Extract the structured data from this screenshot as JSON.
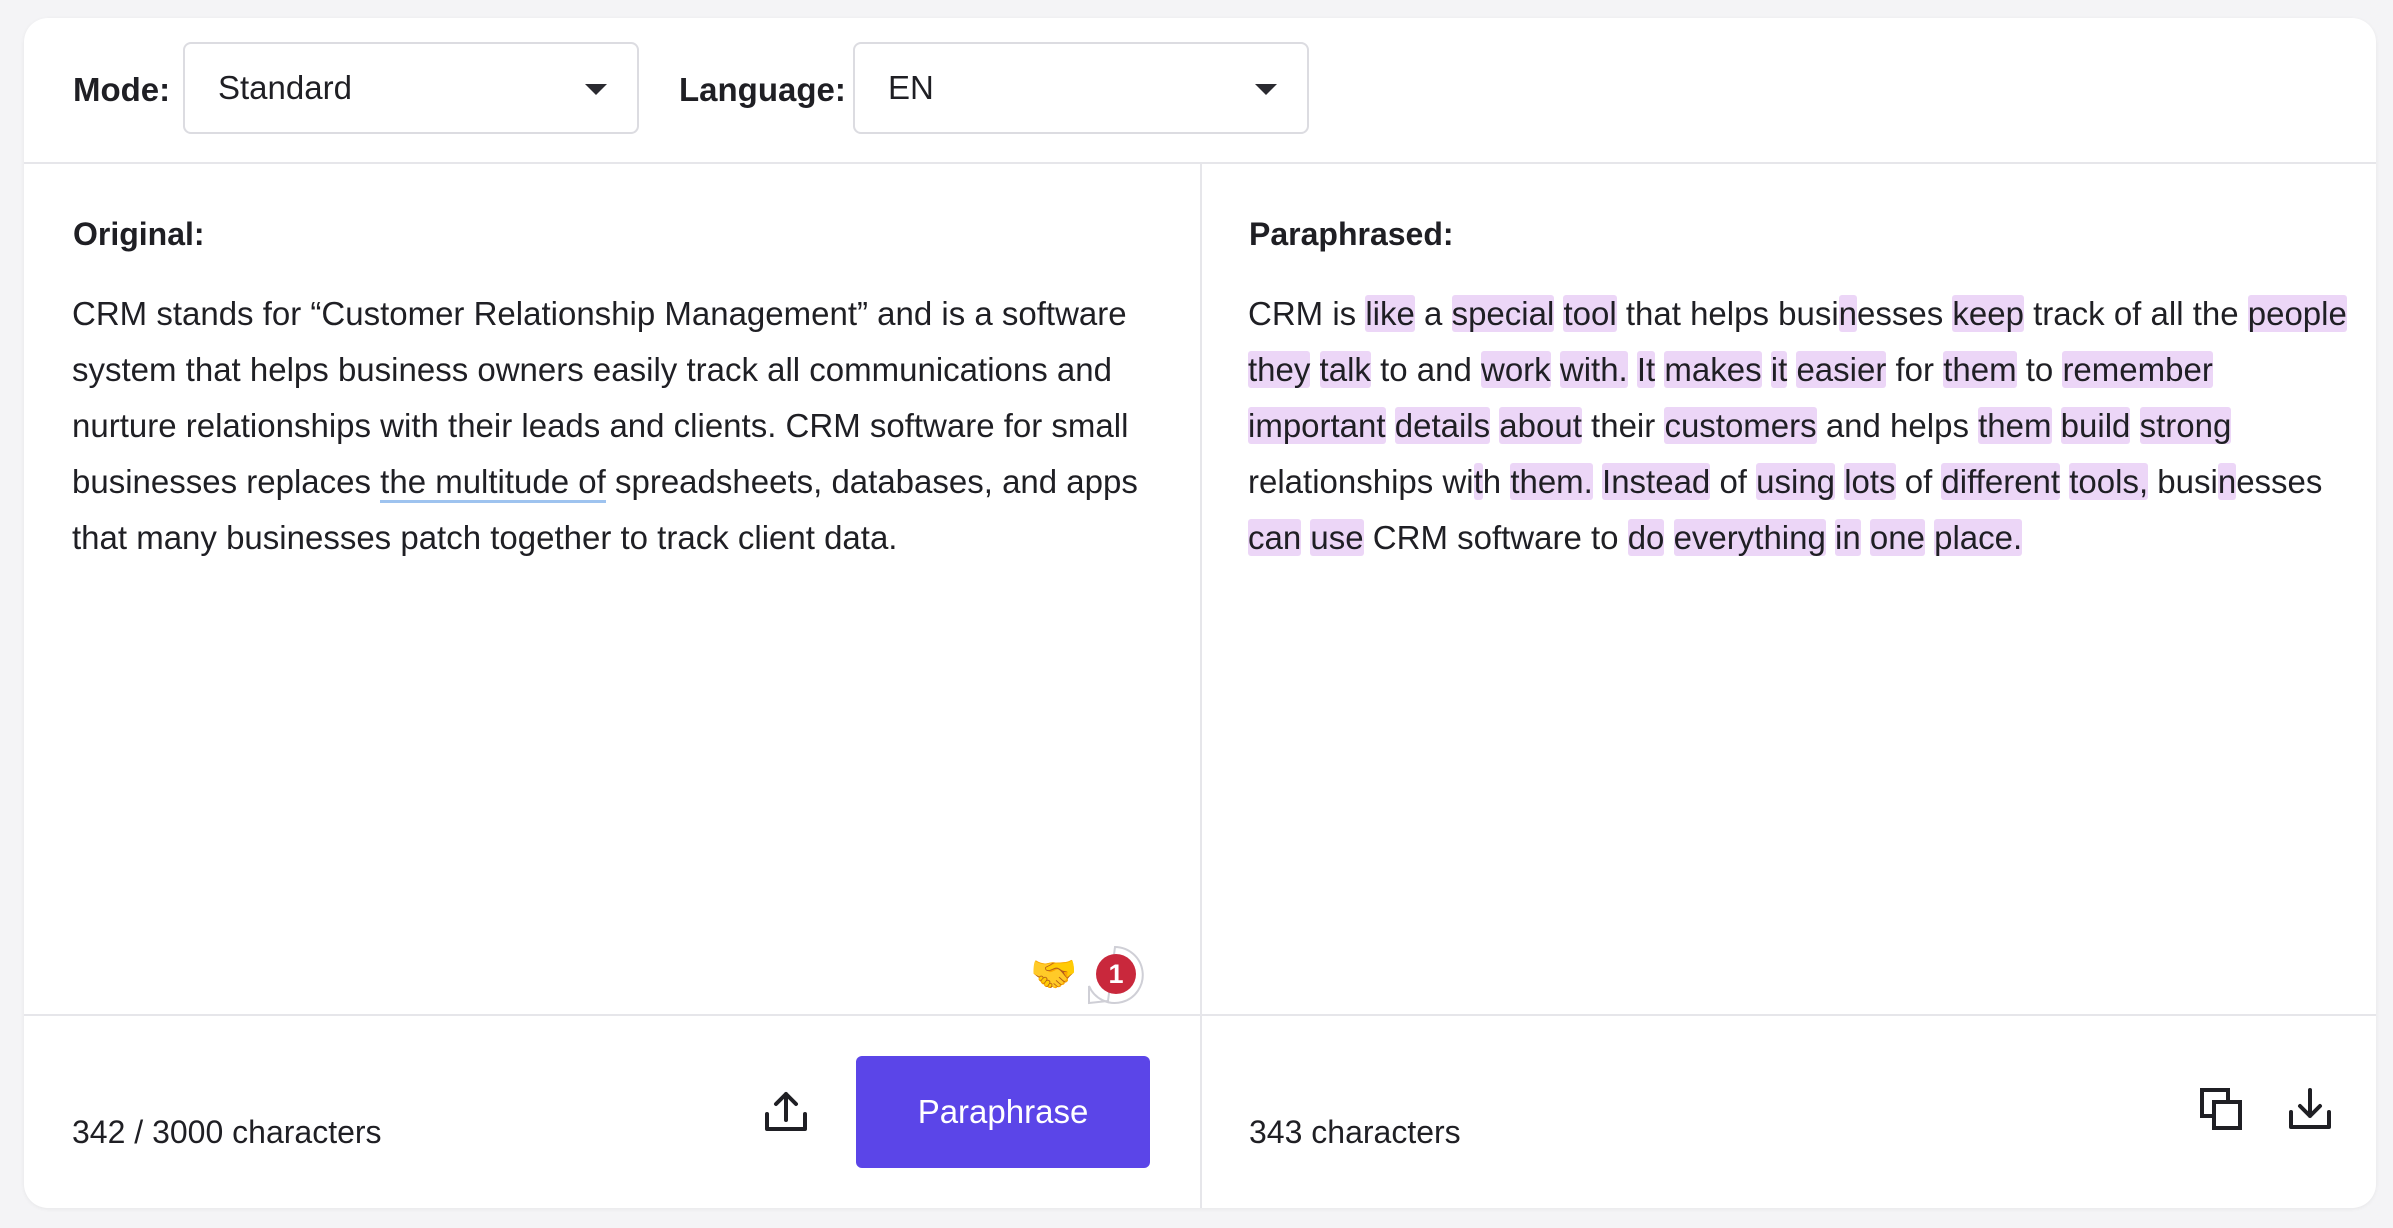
{
  "toolbar": {
    "mode_label": "Mode:",
    "mode_value": "Standard",
    "language_label": "Language:",
    "language_value": "EN"
  },
  "original": {
    "title": "Original:",
    "segments": [
      {
        "t": "CRM stands for “Customer Relationship Management” and is a software system that helps business owners easily track all communications and nurture relationships with their leads and clients. CRM software for small businesses replaces "
      },
      {
        "t": "the multitude of",
        "u": true
      },
      {
        "t": " spreadsheets, databases, and apps that many businesses patch together to track client data."
      }
    ],
    "char_count": "342 / 3000 characters",
    "paraphrase_button": "Paraphrase",
    "emoji": "🤝",
    "badge_count": "1"
  },
  "paraphrased": {
    "title": "Paraphrased:",
    "segments": [
      {
        "t": "CRM is "
      },
      {
        "t": "like",
        "h": true
      },
      {
        "t": " a "
      },
      {
        "t": "special",
        "h": true
      },
      {
        "t": " "
      },
      {
        "t": "tool",
        "h": true
      },
      {
        "t": " that helps busi"
      },
      {
        "t": "n",
        "h": true
      },
      {
        "t": "esses "
      },
      {
        "t": "keep",
        "h": true
      },
      {
        "t": " track of all the "
      },
      {
        "t": "people",
        "h": true
      },
      {
        "t": " "
      },
      {
        "t": "they",
        "h": true
      },
      {
        "t": " "
      },
      {
        "t": "talk",
        "h": true
      },
      {
        "t": " to and "
      },
      {
        "t": "work",
        "h": true
      },
      {
        "t": " "
      },
      {
        "t": "with.",
        "h": true
      },
      {
        "t": " "
      },
      {
        "t": "It",
        "h": true
      },
      {
        "t": " "
      },
      {
        "t": "makes",
        "h": true
      },
      {
        "t": " "
      },
      {
        "t": "it",
        "h": true
      },
      {
        "t": " "
      },
      {
        "t": "easier",
        "h": true
      },
      {
        "t": " for "
      },
      {
        "t": "them",
        "h": true
      },
      {
        "t": " to "
      },
      {
        "t": "remember",
        "h": true
      },
      {
        "t": " "
      },
      {
        "t": "important",
        "h": true
      },
      {
        "t": " "
      },
      {
        "t": "details",
        "h": true
      },
      {
        "t": " "
      },
      {
        "t": "about",
        "h": true
      },
      {
        "t": " their "
      },
      {
        "t": "customers",
        "h": true
      },
      {
        "t": " and helps "
      },
      {
        "t": "them",
        "h": true
      },
      {
        "t": " "
      },
      {
        "t": "build",
        "h": true
      },
      {
        "t": " "
      },
      {
        "t": "strong",
        "h": true
      },
      {
        "t": " relationships wi"
      },
      {
        "t": "t",
        "h": true
      },
      {
        "t": "h "
      },
      {
        "t": "them.",
        "h": true
      },
      {
        "t": " "
      },
      {
        "t": "Instead",
        "h": true
      },
      {
        "t": " of "
      },
      {
        "t": "using",
        "h": true
      },
      {
        "t": " "
      },
      {
        "t": "lots",
        "h": true
      },
      {
        "t": " of "
      },
      {
        "t": "different",
        "h": true
      },
      {
        "t": " "
      },
      {
        "t": "tools,",
        "h": true
      },
      {
        "t": " busi"
      },
      {
        "t": "n",
        "h": true
      },
      {
        "t": "esses "
      },
      {
        "t": "can",
        "h": true
      },
      {
        "t": " "
      },
      {
        "t": "use",
        "h": true
      },
      {
        "t": " CRM software to "
      },
      {
        "t": "do",
        "h": true
      },
      {
        "t": " "
      },
      {
        "t": "everything",
        "h": true
      },
      {
        "t": " "
      },
      {
        "t": "in",
        "h": true
      },
      {
        "t": " "
      },
      {
        "t": "one",
        "h": true
      },
      {
        "t": " "
      },
      {
        "t": "place.",
        "h": true
      }
    ],
    "char_count": "343 characters"
  },
  "icons": {
    "upload": "upload-icon",
    "copy": "copy-icon",
    "download": "download-icon",
    "caret": "chevron-down-icon"
  },
  "colors": {
    "primary": "#5b45e8",
    "highlight": "#ecd6f7",
    "underline": "#9ec3ef",
    "badge": "#c9283c"
  }
}
